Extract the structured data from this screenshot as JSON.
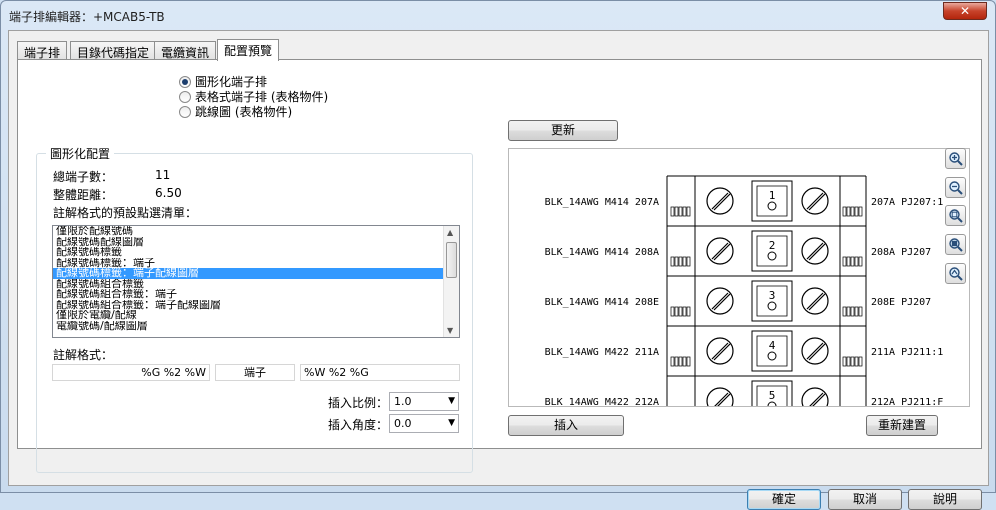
{
  "window": {
    "title": "端子排編輯器：+MCAB5-TB",
    "close_label": "✕"
  },
  "tabs": [
    {
      "label": "端子排"
    },
    {
      "label": "目錄代碼指定"
    },
    {
      "label": "電纜資訊"
    },
    {
      "label": "配置預覽"
    }
  ],
  "style_options": [
    {
      "label": "圖形化端子排",
      "checked": true
    },
    {
      "label": "表格式端子排 (表格物件)",
      "checked": false
    },
    {
      "label": "跳線圖 (表格物件)",
      "checked": false
    }
  ],
  "graphic_config": {
    "legend": "圖形化配置",
    "total_terminals_label": "總端子數：",
    "total_terminals_value": "11",
    "total_distance_label": "整體距離：",
    "total_distance_value": "6.50",
    "preset_list_label": "註解格式的預設點選清單：",
    "preset_items": [
      "僅限於配線號碼",
      "配線號碼配線圖層",
      "配線號碼標籤",
      "配線號碼標籤：端子",
      "配線號碼標籤：端子配線圖層",
      "配線號碼組合標籤",
      "配線號碼組合標籤：端子",
      "配線號碼組合標籤：端子配線圖層",
      "僅限於電纜/配線",
      "電纜號碼/配線圖層"
    ],
    "selected_index": 4,
    "annotation_format_label": "註解格式：",
    "format_left": "%G %2 %W",
    "format_mid": "端子",
    "format_right": "%W %2 %G",
    "insert_scale_label": "插入比例：",
    "insert_scale_value": "1.0",
    "insert_angle_label": "插入角度：",
    "insert_angle_value": "0.0"
  },
  "preview": {
    "update_label": "更新",
    "insert_label": "插入",
    "reset_label": "重新建置",
    "rows": [
      {
        "left": "BLK_14AWG M414 207A",
        "num": "1",
        "right": "207A PJ207:1"
      },
      {
        "left": "BLK_14AWG M414 208A",
        "num": "2",
        "right": "208A PJ207"
      },
      {
        "left": "BLK_14AWG M414 208E",
        "num": "3",
        "right": "208E PJ207"
      },
      {
        "left": "BLK_14AWG M422 211A",
        "num": "4",
        "right": "211A PJ211:1"
      },
      {
        "left": "BLK_14AWG M422 212A",
        "num": "5",
        "right": "212A PJ211:F"
      }
    ],
    "zoom_tools": [
      "zoom-in-icon",
      "zoom-out-icon",
      "zoom-window-icon",
      "zoom-extents-icon",
      "zoom-realtime-icon"
    ]
  },
  "footer": {
    "ok_label": "確定",
    "cancel_label": "取消",
    "help_label": "說明"
  }
}
